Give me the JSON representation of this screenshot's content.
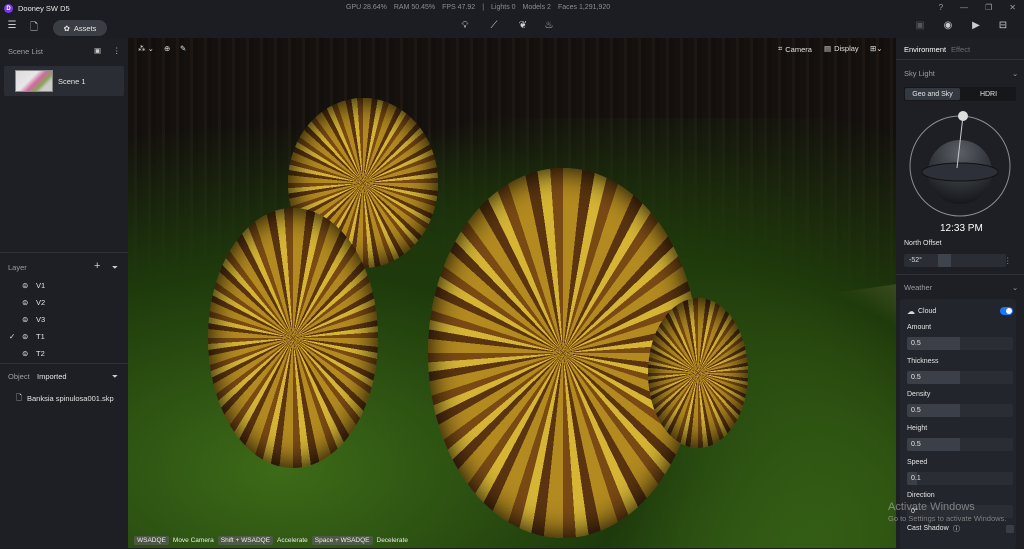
{
  "app": {
    "title": "Dooney SW D5",
    "logo_letter": "D"
  },
  "stats": {
    "gpu": "GPU 28.64%",
    "ram": "RAM 50.45%",
    "fps": "FPS 47.92",
    "sep": "|",
    "lights": "Lights 0",
    "models": "Models 2",
    "faces": "Faces 1,291,920"
  },
  "toolbar": {
    "assets_label": "Assets"
  },
  "scene_list": {
    "title": "Scene List",
    "scenes": [
      {
        "name": "Scene 1"
      }
    ]
  },
  "layers": {
    "title": "Layer",
    "items": [
      {
        "name": "V1",
        "checked": false
      },
      {
        "name": "V2",
        "checked": false
      },
      {
        "name": "V3",
        "checked": false
      },
      {
        "name": "T1",
        "checked": true
      },
      {
        "name": "T2",
        "checked": false
      }
    ]
  },
  "object": {
    "title": "Object",
    "filter": "Imported",
    "files": [
      "Banksia spinulosa001.skp"
    ]
  },
  "viewport": {
    "camera_label": "Camera",
    "display_label": "Display",
    "hints": [
      {
        "key": "WSADQE",
        "action": "Move Camera"
      },
      {
        "key": "Shift + WSADQE",
        "action": "Accelerate"
      },
      {
        "key": "Space + WSADQE",
        "action": "Decelerate"
      }
    ]
  },
  "right": {
    "tabs": [
      "Environment",
      "Effect"
    ],
    "sky_light": "Sky Light",
    "sky_modes": [
      "Geo and Sky",
      "HDRI"
    ],
    "time": "12:33 PM",
    "north_offset_label": "North Offset",
    "north_offset": "-52°",
    "weather": "Weather",
    "cloud_label": "Cloud",
    "cloud_enabled": true,
    "params": [
      {
        "label": "Amount",
        "value": "0.5",
        "fraction": 0.5
      },
      {
        "label": "Thickness",
        "value": "0.5",
        "fraction": 0.5
      },
      {
        "label": "Density",
        "value": "0.5",
        "fraction": 0.5
      },
      {
        "label": "Height",
        "value": "0.5",
        "fraction": 0.5
      },
      {
        "label": "Speed",
        "value": "0.1",
        "fraction": 0.1
      },
      {
        "label": "Direction",
        "value": "0°",
        "fraction": 0
      }
    ],
    "cast_shadow": "Cast Shadow"
  },
  "watermark": {
    "line1": "Activate Windows",
    "line2": "Go to Settings to activate Windows."
  }
}
